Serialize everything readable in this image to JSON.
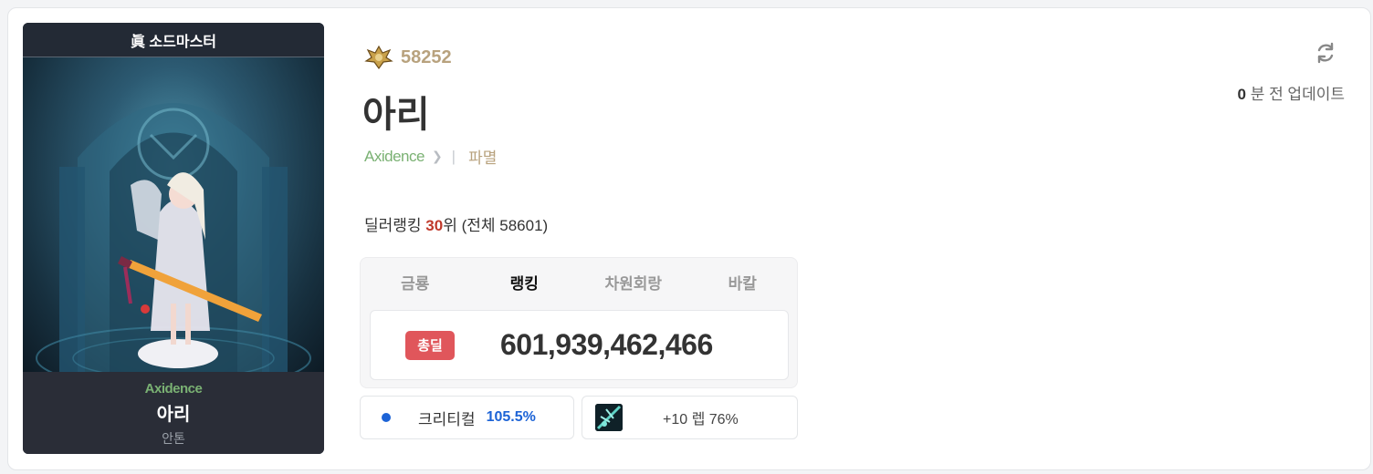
{
  "portrait": {
    "title": "眞 소드마스터",
    "adventure": "Axidence",
    "name": "아리",
    "server": "안톤"
  },
  "profile": {
    "fame_icon": "fame-emblem-icon",
    "fame": "58252",
    "name": "아리",
    "adventure": "Axidence",
    "guild": "파멸"
  },
  "update": {
    "icon": "refresh-icon",
    "minutes": "0",
    "suffix": "분 전 업데이트"
  },
  "ranking": {
    "prefix": "딜러랭킹",
    "rank": "30",
    "rank_unit": "위",
    "total": "(전체 58601)"
  },
  "tabs": [
    {
      "label": "금룡",
      "active": false
    },
    {
      "label": "랭킹",
      "active": true
    },
    {
      "label": "차원회랑",
      "active": false
    },
    {
      "label": "바칼",
      "active": false
    }
  ],
  "damage": {
    "badge": "총딜",
    "value": "601,939,462,466"
  },
  "stats": {
    "crit_label": "크리티컬",
    "crit_value": "105.5%",
    "weapon_text": "+10 렙 76%"
  },
  "colors": {
    "fame": "#b8a27e",
    "adventure": "#7ab173",
    "rank": "#c0392b",
    "badge": "#e0565b",
    "crit": "#1c63d6"
  }
}
